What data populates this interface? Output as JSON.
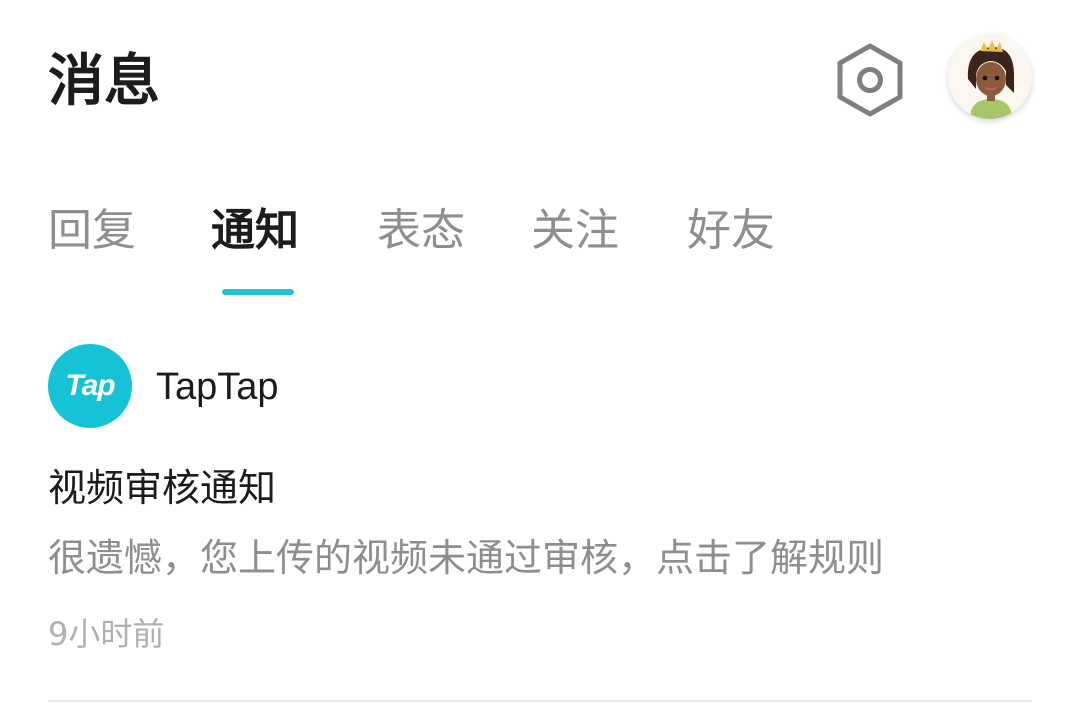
{
  "header": {
    "title": "消息",
    "settings_icon": "hexagon-settings-icon",
    "avatar_icon": "user-avatar"
  },
  "tabs": [
    {
      "label": "回复",
      "active": false
    },
    {
      "label": "通知",
      "active": true
    },
    {
      "label": "表态",
      "active": false
    },
    {
      "label": "关注",
      "active": false
    },
    {
      "label": "好友",
      "active": false
    }
  ],
  "notification": {
    "source": {
      "logo_text": "Tap",
      "name": "TapTap"
    },
    "title": "视频审核通知",
    "body": "很遗憾，您上传的视频未通过审核，点击了解规则",
    "time": "9小时前"
  },
  "colors": {
    "accent": "#18c4d6",
    "text_primary": "#1c1c1c",
    "text_secondary": "#8e8e8e",
    "text_muted": "#b0b0b0",
    "divider": "#ececec"
  }
}
